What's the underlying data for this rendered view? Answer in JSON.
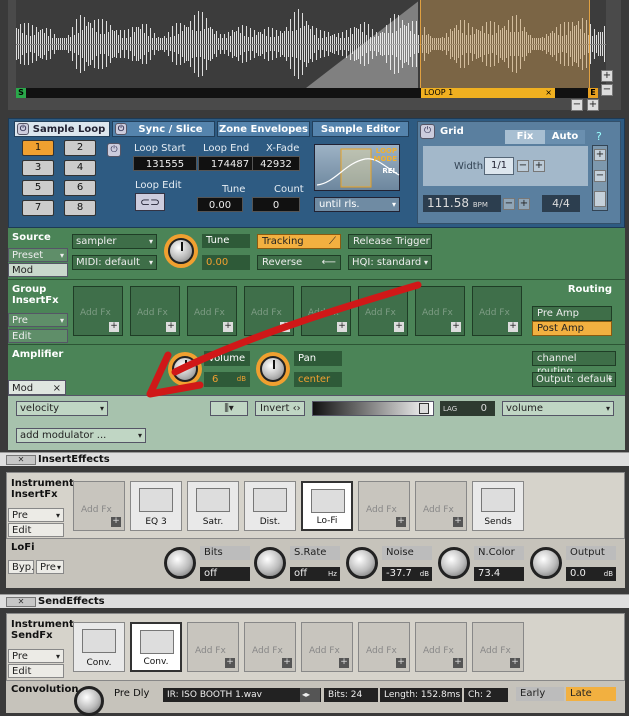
{
  "waveform": {
    "start_marker": "S",
    "end_marker": "E",
    "loop_label": "LOOP 1",
    "loop_close": "×",
    "zoom_plus": "+",
    "zoom_minus": "−"
  },
  "sample_panel": {
    "tabs": [
      {
        "label": "Sample Loop"
      },
      {
        "label": "Sync / Slice"
      },
      {
        "label": "Zone Envelopes"
      },
      {
        "label": "Sample Editor"
      }
    ],
    "loop_buttons": [
      "1",
      "2",
      "3",
      "4",
      "5",
      "6",
      "7",
      "8"
    ],
    "loop_start_label": "Loop Start",
    "loop_start_value": "131555",
    "loop_end_label": "Loop End",
    "loop_end_value": "174487",
    "xfade_label": "X-Fade",
    "xfade_value": "42932",
    "loop_edit_label": "Loop Edit",
    "tune_label": "Tune",
    "tune_value": "0.00",
    "count_label": "Count",
    "count_value": "0",
    "loop_mode_label": "LOOP MODE",
    "rel_label": "REL",
    "mode_select": "until rls.",
    "grid_title": "Grid",
    "grid_fix": "Fix",
    "grid_auto": "Auto",
    "width_label": "Width",
    "width_value": "1/1",
    "bpm_value": "111.58",
    "bpm_unit": "BPM",
    "time_sig": "4/4",
    "minus": "−",
    "plus": "+"
  },
  "source": {
    "title": "Source",
    "preset_tab": "Preset",
    "mod_tab": "Mod",
    "mode_select": "sampler",
    "midi_select": "MIDI: default",
    "tune_label": "Tune",
    "tune_value": "0.00",
    "tracking_label": "Tracking",
    "reverse_label": "Reverse",
    "release_trigger": "Release Trigger",
    "hqi_select": "HQI: standard"
  },
  "group_fx": {
    "title": "Group InsertFx",
    "pre_tab": "Pre",
    "edit_tab": "Edit",
    "slot_label": "Add Fx",
    "routing_title": "Routing",
    "pre_amp": "Pre Amp",
    "post_amp": "Post Amp"
  },
  "amplifier": {
    "title": "Amplifier",
    "volume_label": "Volume",
    "volume_value": "6",
    "volume_unit": "dB",
    "pan_label": "Pan",
    "pan_value": "center",
    "channel_routing": "channel routing",
    "output_select": "Output: default",
    "mod_tab": "Mod",
    "mod_close": "×",
    "mod_source": "velocity",
    "invert_label": "Invert",
    "lag_label": "LAG",
    "lag_value": "0",
    "mod_target": "volume",
    "add_modulator": "add modulator ..."
  },
  "insert_effects": {
    "bar_label": "InsertEffects",
    "title": "Instrument InsertFx",
    "pre_tab": "Pre",
    "edit_tab": "Edit",
    "slots": [
      {
        "label": "Add Fx",
        "filled": false
      },
      {
        "label": "EQ 3",
        "filled": true
      },
      {
        "label": "Satr.",
        "filled": true
      },
      {
        "label": "Dist.",
        "filled": true
      },
      {
        "label": "Lo-Fi",
        "filled": true
      },
      {
        "label": "Add Fx",
        "filled": false
      },
      {
        "label": "Add Fx",
        "filled": false
      },
      {
        "label": "Sends",
        "filled": true
      }
    ],
    "lofi_title": "LoFi",
    "byp": "Byp.",
    "pre_select": "Pre",
    "params": [
      {
        "label": "Bits",
        "value": "off",
        "unit": ""
      },
      {
        "label": "S.Rate",
        "value": "off",
        "unit": "Hz"
      },
      {
        "label": "Noise",
        "value": "-37.7",
        "unit": "dB"
      },
      {
        "label": "N.Color",
        "value": "73.4",
        "unit": ""
      },
      {
        "label": "Output",
        "value": "0.0",
        "unit": "dB"
      }
    ]
  },
  "send_effects": {
    "bar_label": "SendEffects",
    "title": "Instrument SendFx",
    "pre_tab": "Pre",
    "edit_tab": "Edit",
    "slots": [
      {
        "label": "Conv.",
        "filled": true
      },
      {
        "label": "Conv.",
        "filled": true
      },
      {
        "label": "Add Fx",
        "filled": false
      },
      {
        "label": "Add Fx",
        "filled": false
      },
      {
        "label": "Add Fx",
        "filled": false
      },
      {
        "label": "Add Fx",
        "filled": false
      },
      {
        "label": "Add Fx",
        "filled": false
      },
      {
        "label": "Add Fx",
        "filled": false
      }
    ],
    "convolution_title": "Convolution",
    "pre_dly": "Pre Dly",
    "ir_label": "IR: ISO BOOTH 1.wav",
    "bits_label": "Bits: 24",
    "length_label": "Length: 152.8ms",
    "ch_label": "Ch: 2",
    "early": "Early",
    "late": "Late"
  },
  "colors": {
    "accent": "#f0a030",
    "annotation_arrow": "#d01818"
  }
}
